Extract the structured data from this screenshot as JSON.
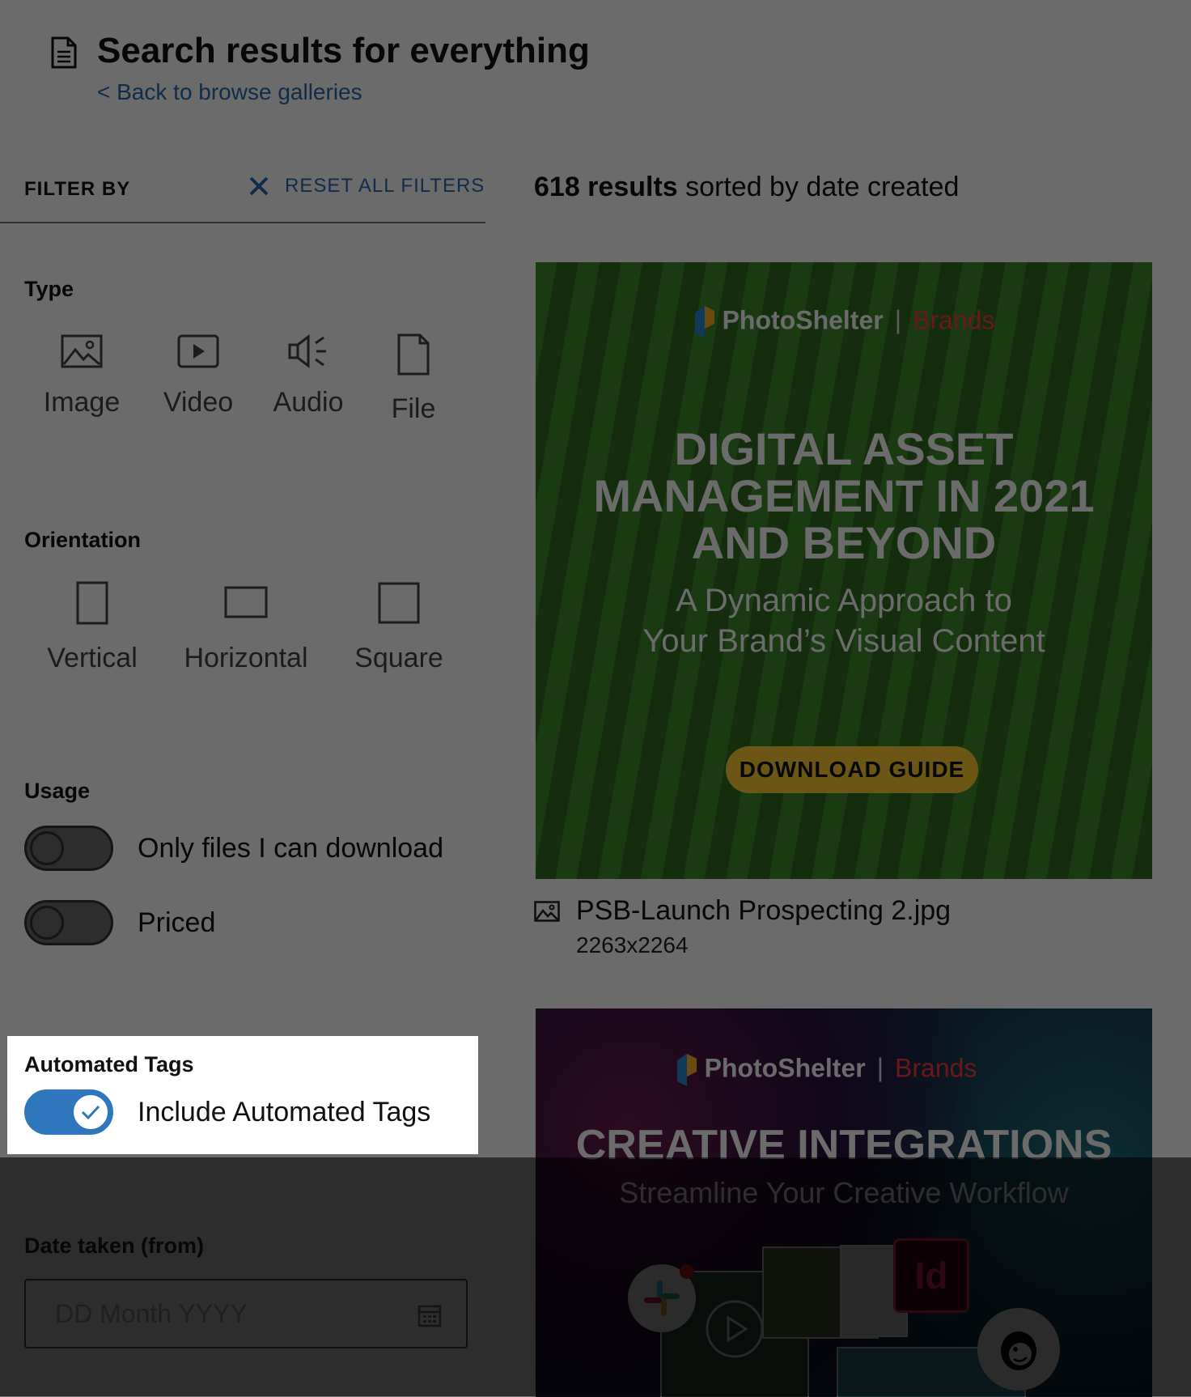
{
  "header": {
    "title": "Search results for everything",
    "back_link": "< Back to browse galleries",
    "icon": "document-icon"
  },
  "filters": {
    "heading": "FILTER BY",
    "reset_label": "RESET ALL FILTERS",
    "type": {
      "label": "Type",
      "options": [
        {
          "label": "Image",
          "icon": "image-icon"
        },
        {
          "label": "Video",
          "icon": "video-icon"
        },
        {
          "label": "Audio",
          "icon": "audio-icon"
        },
        {
          "label": "File",
          "icon": "file-icon"
        }
      ]
    },
    "orientation": {
      "label": "Orientation",
      "options": [
        {
          "label": "Vertical",
          "icon": "vertical-rect-icon"
        },
        {
          "label": "Horizontal",
          "icon": "horizontal-rect-icon"
        },
        {
          "label": "Square",
          "icon": "square-icon"
        }
      ]
    },
    "usage": {
      "label": "Usage",
      "toggles": [
        {
          "label": "Only files I can download",
          "on": false
        },
        {
          "label": "Priced",
          "on": false
        }
      ]
    },
    "automated_tags": {
      "label": "Automated Tags",
      "toggle": {
        "label": "Include Automated Tags",
        "on": true
      }
    },
    "date_from": {
      "label": "Date taken (from)",
      "placeholder": "DD Month YYYY"
    }
  },
  "results": {
    "count": "618 results",
    "sort_text": " sorted by date created",
    "items": [
      {
        "brand": "PhotoShelter",
        "brand_sub": "Brands",
        "headline_lines": [
          "DIGITAL ASSET",
          "MANAGEMENT IN 2021",
          "AND BEYOND"
        ],
        "subline_lines": [
          "A Dynamic Approach to",
          "Your Brand’s Visual Content"
        ],
        "cta": "DOWNLOAD GUIDE",
        "file_name": "PSB-Launch Prospecting 2.jpg",
        "dimensions": "2263x2264"
      },
      {
        "brand": "PhotoShelter",
        "brand_sub": "Brands",
        "headline": "CREATIVE INTEGRATIONS",
        "subline": "Streamline Your Creative Workflow",
        "id_badge": "Id"
      }
    ]
  },
  "colors": {
    "link": "#2a6ab0",
    "toggle_on": "#2e77bd",
    "cta": "#ffcc33",
    "brand_red": "#ff3a3a"
  }
}
